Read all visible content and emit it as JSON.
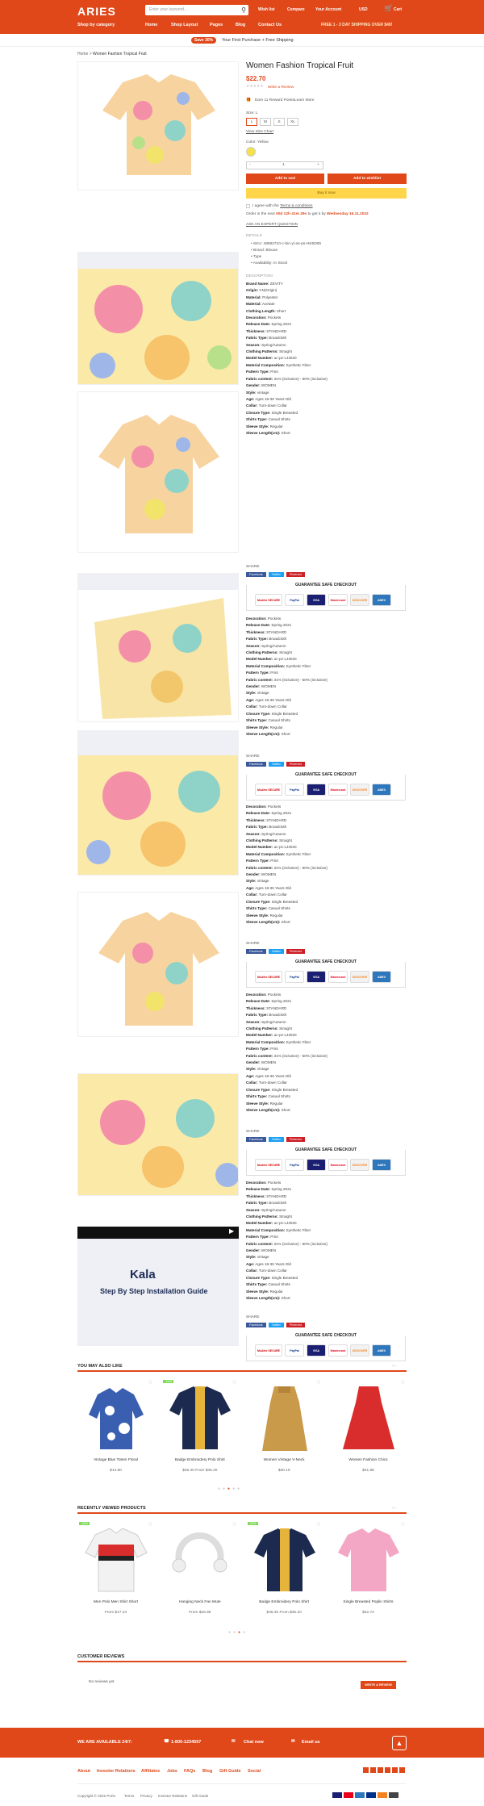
{
  "header": {
    "logo": "ARIES",
    "search_placeholder": "Enter your keyword...",
    "top_links": [
      "Wish list",
      "Compare",
      "Your Account",
      "USD",
      "Cart"
    ],
    "nav": [
      "Shop by category",
      "Home",
      "Shop Layout",
      "Pages",
      "Blog",
      "Contact Us"
    ],
    "promo_right": "FREE 1 - 3 DAY SHIPPING OVER $49!"
  },
  "promo_bar": {
    "pill": "Save 30%",
    "text": "Your First Purchase + Free Shipping"
  },
  "breadcrumb": {
    "home": "Home",
    "sep": ">",
    "current": "Women Fashion Tropical Fruit"
  },
  "product": {
    "title": "Women Fashion Tropical Fruit",
    "price": "$22.70",
    "write_review": "Write a Review",
    "reward": "Earn 11 Reward Points",
    "learn_more": "Learn More",
    "size_label": "Size: L",
    "sizes": [
      "L",
      "M",
      "S",
      "XL"
    ],
    "size_chart": "View Size Chart",
    "color_label": "Color: Yellow",
    "qty_minus": "-",
    "qty_value": "1",
    "qty_plus": "+",
    "add_to_cart": "Add to cart",
    "add_to_wishlist": "Add to wishlist",
    "buy_now": "Buy it now",
    "terms_pre": "I agree with the",
    "terms_link": "Terms & conditions",
    "order_pre": "Order in the next",
    "order_time": "00d 12h 41m 29s",
    "order_mid": "to get it by",
    "order_date": "Wednesday 16.11.2022",
    "ask": "ASK AN EXPERT QUESTION",
    "details_h": "DETAILS",
    "details": [
      "SKU: 48582710-c-bin-yl-as-ps-HK5D95",
      "Brand: Blouse",
      "Type",
      "Availability: In Stock"
    ],
    "desc_h": "DESCRIPTION",
    "specs": [
      [
        "Brand Name:",
        "ZEVITY"
      ],
      [
        "Origin:",
        "CN(Origin)"
      ],
      [
        "Material:",
        "Polyester"
      ],
      [
        "Material:",
        "Acetate"
      ],
      [
        "Clothing Length:",
        "Short"
      ],
      [
        "Decoration:",
        "Pockets"
      ],
      [
        "Release Date:",
        "Spring 2021"
      ],
      [
        "Thickness:",
        "STANDARD"
      ],
      [
        "Fabric Type:",
        "Broadcloth"
      ],
      [
        "Season:",
        "Spring/Autumn"
      ],
      [
        "Clothing Patterns:",
        "Straight"
      ],
      [
        "Model Number:",
        "ac-pz-LJ3020"
      ],
      [
        "Material Composition:",
        "Synthetic Fiber"
      ],
      [
        "Pattern Type:",
        "Print"
      ],
      [
        "Fabric content:",
        "31% (inclusive) - 50% (inclusive)"
      ],
      [
        "Gender:",
        "WOMEN"
      ],
      [
        "Style:",
        "vintage"
      ],
      [
        "Age:",
        "Ages 18-35 Years Old"
      ],
      [
        "Collar:",
        "Turn-down Collar"
      ],
      [
        "Closure Type:",
        "Single Breasted"
      ],
      [
        "Shirts Type:",
        "Casual Shirts"
      ],
      [
        "Sleeve Style:",
        "Regular"
      ],
      [
        "Sleeve Length(cm):",
        "Short"
      ]
    ],
    "specs2": [
      [
        "Decoration:",
        "Pockets"
      ],
      [
        "Release Date:",
        "Spring 2021"
      ],
      [
        "Thickness:",
        "STANDARD"
      ],
      [
        "Fabric Type:",
        "Broadcloth"
      ],
      [
        "Season:",
        "Spring/Autumn"
      ],
      [
        "Clothing Patterns:",
        "Straight"
      ],
      [
        "Model Number:",
        "ac-pz-LJ3020"
      ],
      [
        "Material Composition:",
        "Synthetic Fiber"
      ],
      [
        "Pattern Type:",
        "Print"
      ],
      [
        "Fabric content:",
        "31% (inclusive) - 50% (inclusive)"
      ],
      [
        "Gender:",
        "WOMEN"
      ],
      [
        "Style:",
        "vintage"
      ],
      [
        "Age:",
        "Ages 18-35 Years Old"
      ],
      [
        "Collar:",
        "Turn-down Collar"
      ],
      [
        "Closure Type:",
        "Single Breasted"
      ],
      [
        "Shirts Type:",
        "Casual Shirts"
      ],
      [
        "Sleeve Style:",
        "Regular"
      ],
      [
        "Sleeve Length(cm):",
        "Short"
      ]
    ],
    "share_label": "SHARE",
    "share_buttons": [
      "Facebook",
      "Twitter",
      "Pinterest"
    ],
    "guarantee": "GUARANTEE SAFE CHECKOUT",
    "badges": [
      "McAfee SECURE",
      "PayPal",
      "VISA",
      "Mastercard",
      "DISCOVER",
      "AMEX"
    ]
  },
  "video": {
    "brand": "Kala",
    "caption": "Step By Step Installation Guide"
  },
  "also_like": {
    "heading": "YOU MAY ALSO LIKE",
    "items": [
      {
        "name": "Vintage Blue Totem Floral",
        "price": "$14.80",
        "badge": ""
      },
      {
        "name": "Badge Embroidery Polo Shirt",
        "price": "$46.40 From $35.20",
        "badge": "-24%"
      },
      {
        "name": "Women Vintage V-Neck",
        "price": "$30.19",
        "badge": ""
      },
      {
        "name": "Women Fashion Chics",
        "price": "$31.98",
        "badge": ""
      }
    ]
  },
  "recently": {
    "heading": "RECENTLY VIEWED PRODUCTS",
    "items": [
      {
        "name": "Men Polo Men Shirt Short",
        "price": "From $17.24",
        "badge": "-16%"
      },
      {
        "name": "Hanging Neck Fan Mute",
        "price": "From $25.99",
        "badge": ""
      },
      {
        "name": "Badge Embroidery Polo Shirt",
        "price": "$46.40 From $35.20",
        "badge": "-24%"
      },
      {
        "name": "Single Breasted Poplin Shirts",
        "price": "$32.72",
        "badge": ""
      }
    ]
  },
  "reviews": {
    "heading": "CUSTOMER REVIEWS",
    "empty": "No reviews yet",
    "button": "WRITE A REVIEW"
  },
  "footer": {
    "available": "WE ARE AVAILABLE 24/7:",
    "phone": "1-800-1234567",
    "chat": "Chat now",
    "email": "Email us",
    "links": [
      "About",
      "Investor Relations",
      "Affiliates",
      "Jobs",
      "FAQs",
      "Blog",
      "Gift Guide",
      "Social"
    ],
    "copyright": "Copyright © 2022 Porto",
    "bottom_links": [
      "Terms",
      "Privacy",
      "Investor Relations",
      "Gift Guide"
    ]
  },
  "colors": {
    "accent": "#e0481a",
    "facebook": "#3b5998",
    "twitter": "#1da1f2",
    "pinterest": "#cb2027"
  }
}
